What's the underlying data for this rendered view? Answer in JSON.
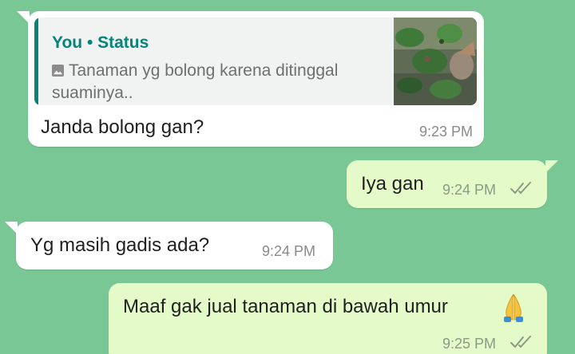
{
  "messages": [
    {
      "direction": "incoming",
      "reply": {
        "author": "You • Status",
        "media_icon": "photo-icon",
        "text": "Tanaman yg bolong karena ditinggal suaminya.."
      },
      "text": "Janda bolong gan?",
      "time": "9:23 PM"
    },
    {
      "direction": "outgoing",
      "text": "Iya gan",
      "time": "9:24 PM",
      "status_icon": "double-check-icon"
    },
    {
      "direction": "incoming",
      "text": "Yg masih gadis ada?",
      "time": "9:24 PM"
    },
    {
      "direction": "outgoing",
      "text": "Maaf gak jual tanaman di bawah umur",
      "emoji": "folded-hands-emoji",
      "time": "9:25 PM",
      "status_icon": "double-check-icon"
    }
  ],
  "colors": {
    "background": "#79c795",
    "incoming_bubble": "#ffffff",
    "outgoing_bubble": "#e4fbc9",
    "accent": "#06847a",
    "timestamp": "#8a8a8a",
    "read_ticks": "#8b9a84"
  }
}
